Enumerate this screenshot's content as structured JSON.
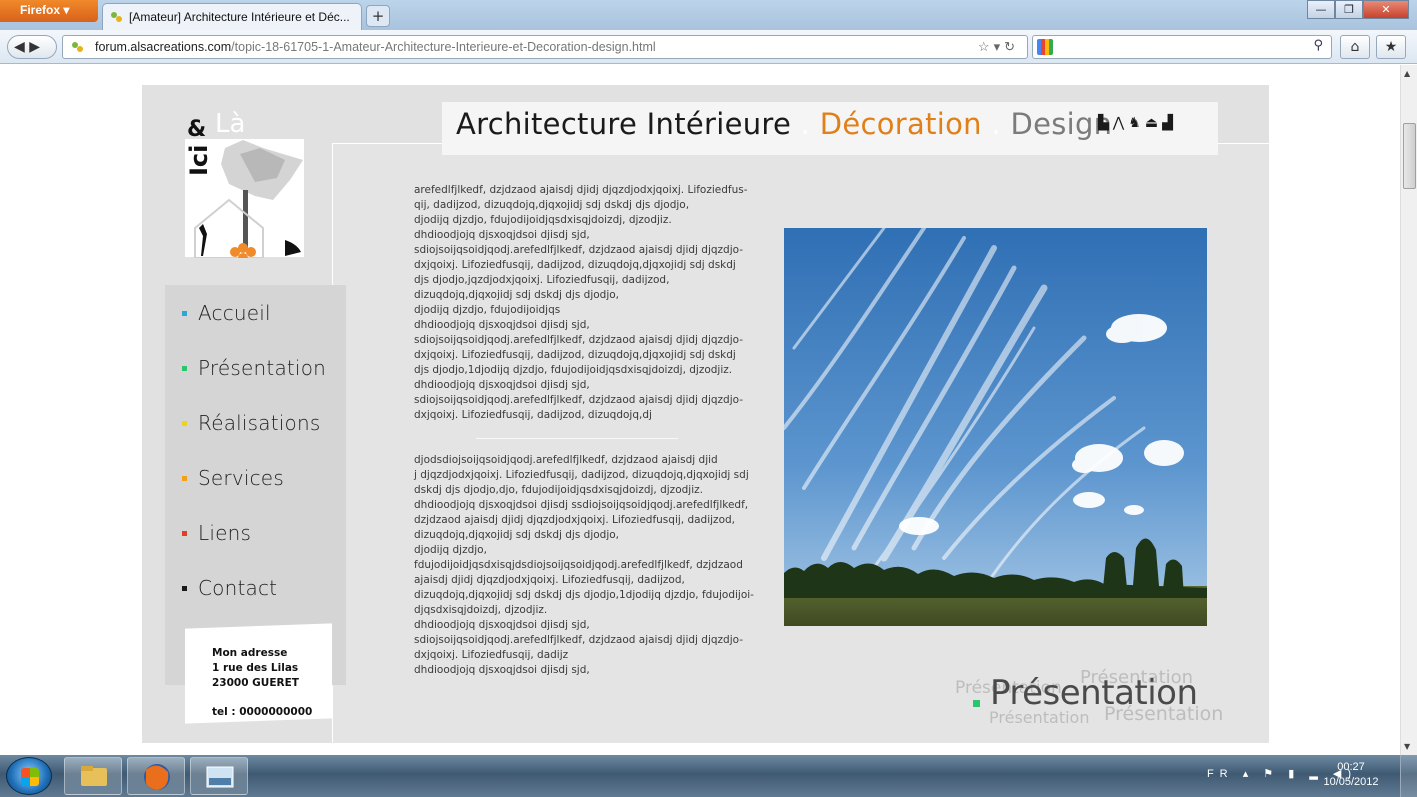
{
  "browser": {
    "app_button": "Firefox",
    "tab_title": "[Amateur] Architecture Intérieure et Déc...",
    "new_tab": "+",
    "url_host": "forum.alsacreations.com",
    "url_path": "/topic-18-61705-1-Amateur-Architecture-Interieure-et-Decoration-design.html",
    "window_buttons": [
      "—",
      "❐",
      "✕"
    ]
  },
  "site": {
    "logo": {
      "amp": "&",
      "la": "Là",
      "ici": "Ici"
    },
    "header": {
      "part1": "Architecture Intérieure",
      "sep": ".",
      "part2": "Décoration",
      "sep2": ".",
      "part3": "Design"
    },
    "menu": [
      {
        "label": "Accueil",
        "bullet": "#2aa7d6"
      },
      {
        "label": "Présentation",
        "bullet": "#29c66b"
      },
      {
        "label": "Réalisations",
        "bullet": "#e8d51c"
      },
      {
        "label": "Services",
        "bullet": "#f0a21a"
      },
      {
        "label": "Liens",
        "bullet": "#e0402a"
      },
      {
        "label": "Contact",
        "bullet": "#1a1a1a"
      }
    ],
    "address": {
      "line1": "Mon adresse",
      "line2": "1 rue des Lilas",
      "line3": "23000 GUERET",
      "phone": "tel : 0000000000"
    },
    "paragraph1": [
      "arefedlfjlkedf, dzjdzaod ajaisdj djidj djqzdjodxjqoixj. Lifoziedfus-",
      "qij, dadijzod, dizuqdojq,djqxojidj sdj dskdj djs djodjo,",
      "djodijq djzdjo, fdujodijoidjqsdxisqjdoizdj, djzodjiz.",
      "dhdioodjojq djsxoqjdsoi djisdj sjd,",
      "sdiojsoijqsoidjqodj.arefedlfjlkedf, dzjdzaod ajaisdj djidj djqzdjo-",
      "dxjqoixj. Lifoziedfusqij, dadijzod, dizuqdojq,djqxojidj sdj dskdj",
      "djs djodjo,jqzdjodxjqoixj. Lifoziedfusqij, dadijzod,",
      "dizuqdojq,djqxojidj sdj dskdj djs djodjo,",
      "djodijq djzdjo, fdujodijoidjqs",
      "dhdioodjojq djsxoqjdsoi djisdj sjd,",
      "sdiojsoijqsoidjqodj.arefedlfjlkedf, dzjdzaod ajaisdj djidj djqzdjo-",
      "dxjqoixj. Lifoziedfusqij, dadijzod, dizuqdojq,djqxojidj sdj dskdj",
      "djs djodjo,1djodijq djzdjo, fdujodijoidjqsdxisqjdoizdj, djzodjiz.",
      "dhdioodjojq djsxoqjdsoi djisdj sjd,",
      "sdiojsoijqsoidjqodj.arefedlfjlkedf, dzjdzaod ajaisdj djidj djqzdjo-",
      "dxjqoixj. Lifoziedfusqij, dadijzod, dizuqdojq,dj"
    ],
    "paragraph2": [
      "djodsdiojsoijqsoidjqodj.arefedlfjlkedf, dzjdzaod ajaisdj djid",
      "j djqzdjodxjqoixj. Lifoziedfusqij, dadijzod, dizuqdojq,djqxojidj sdj",
      "dskdj djs djodjo,djo, fdujodijoidjqsdxisqjdoizdj, djzodjiz.",
      "dhdioodjojq djsxoqjdsoi djisdj ssdiojsoijqsoidjqodj.arefedlfjlkedf,",
      "dzjdzaod ajaisdj djidj djqzdjodxjqoixj. Lifoziedfusqij, dadijzod,",
      "dizuqdojq,djqxojidj sdj dskdj djs djodjo,",
      "djodijq djzdjo,",
      "fdujodijoidjqsdxisqjdsdiojsoijqsoidjqodj.arefedlfjlkedf, dzjdzaod",
      "ajaisdj djidj djqzdjodxjqoixj. Lifoziedfusqij, dadijzod,",
      "dizuqdojq,djqxojidj sdj dskdj djs djodjo,1djodijq djzdjo, fdujodijoi-",
      "djqsdxisqjdoizdj, djzodjiz.",
      "dhdioodjojq djsxoqjdsoi djisdj sjd,",
      "sdiojsoijqsoidjqodj.arefedlfjlkedf, dzjdzaod ajaisdj djidj djqzdjo-",
      "dxjqoixj. Lifoziedfusqij, dadijz",
      "dhdioodjojq djsxoqjdsoi djisdj sjd,"
    ],
    "section_title": "Présentation",
    "section_title_echo": "Présentation",
    "section_bullet_color": "#29c66b"
  },
  "taskbar": {
    "language": "FR",
    "time": "00:27",
    "date": "10/05/2012"
  },
  "colors": {
    "accent_orange": "#e0801b",
    "page_bg": "#e1e1e1"
  }
}
